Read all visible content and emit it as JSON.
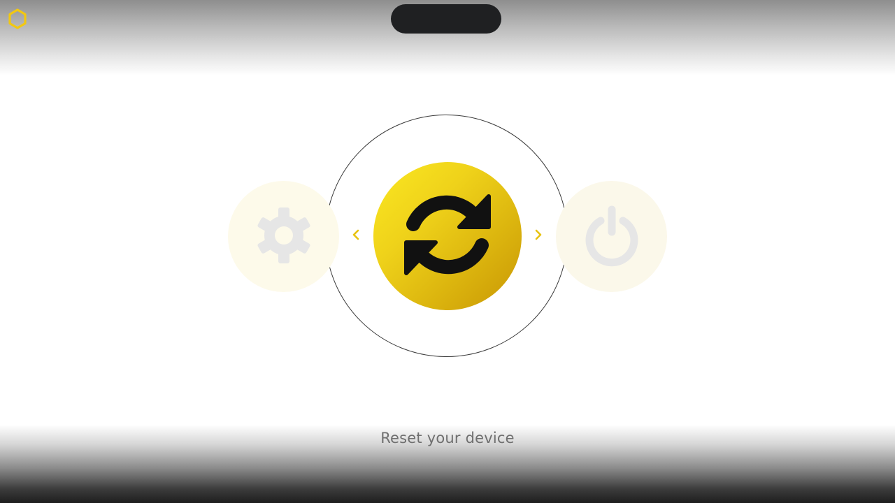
{
  "screen": {
    "caption": "Reset your device"
  },
  "carousel": {
    "items": [
      {
        "id": "settings",
        "icon": "gear-icon",
        "state": "inactive"
      },
      {
        "id": "reset",
        "icon": "refresh-icon",
        "state": "selected"
      },
      {
        "id": "power",
        "icon": "power-icon",
        "state": "inactive"
      }
    ],
    "prev_icon": "chevron-left-icon",
    "next_icon": "chevron-right-icon"
  },
  "header": {
    "logo_icon": "hexagon-logo-icon",
    "notch": "camera-notch"
  },
  "colors": {
    "accent": "#f2c811",
    "accent_dark": "#c89604",
    "icon_inactive": "#e6e6e6",
    "caption": "#6f6f6f",
    "notch": "#1f2022"
  }
}
